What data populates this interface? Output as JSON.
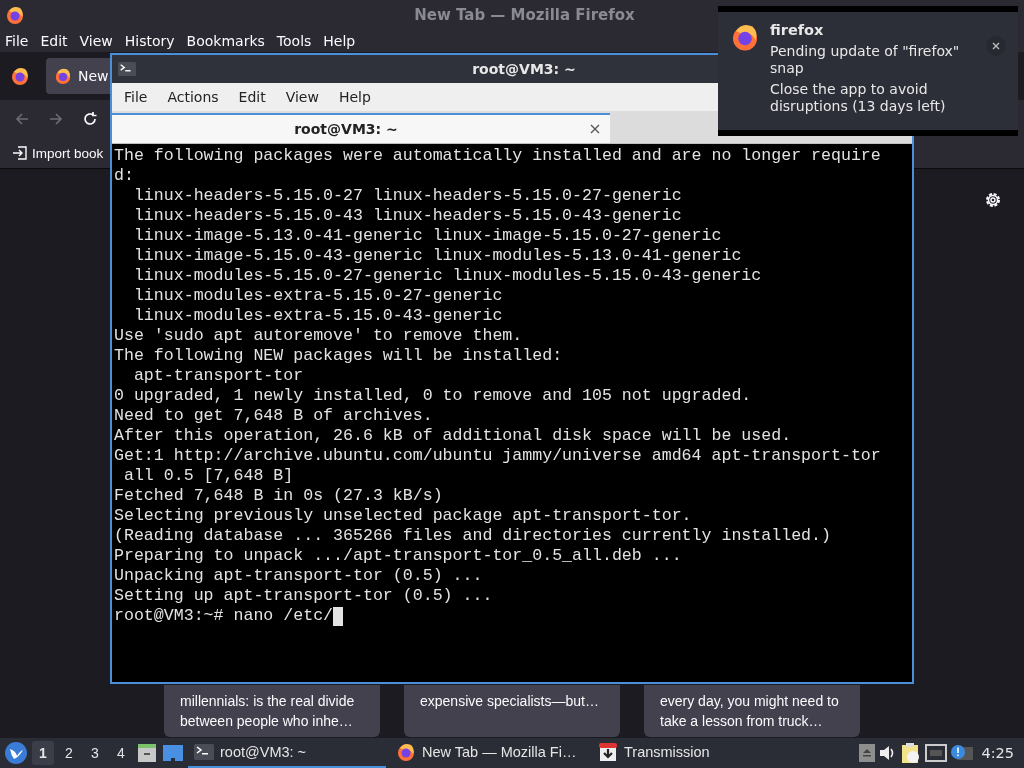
{
  "browser": {
    "title": "New Tab — Mozilla Firefox",
    "menu": [
      "File",
      "Edit",
      "View",
      "History",
      "Bookmarks",
      "Tools",
      "Help"
    ],
    "tabs": [
      {
        "label": "New",
        "selected": true
      }
    ],
    "bookmarks": [
      {
        "label": "Import book"
      }
    ],
    "cards": [
      {
        "text": "millennials: is the real divide\nbetween people who inhe…"
      },
      {
        "text": "expensive specialists—but…"
      },
      {
        "text": "every day, you might need to\ntake a lesson from truck…"
      }
    ]
  },
  "terminal": {
    "title": "root@VM3: ~",
    "menu": [
      "File",
      "Actions",
      "Edit",
      "View",
      "Help"
    ],
    "tabs": [
      {
        "label": "root@VM3: ~",
        "selected": true
      }
    ],
    "lines": [
      "The following packages were automatically installed and are no longer require",
      "d:",
      "  linux-headers-5.15.0-27 linux-headers-5.15.0-27-generic",
      "  linux-headers-5.15.0-43 linux-headers-5.15.0-43-generic",
      "  linux-image-5.13.0-41-generic linux-image-5.15.0-27-generic",
      "  linux-image-5.15.0-43-generic linux-modules-5.13.0-41-generic",
      "  linux-modules-5.15.0-27-generic linux-modules-5.15.0-43-generic",
      "  linux-modules-extra-5.15.0-27-generic",
      "  linux-modules-extra-5.15.0-43-generic",
      "Use 'sudo apt autoremove' to remove them.",
      "The following NEW packages will be installed:",
      "  apt-transport-tor",
      "0 upgraded, 1 newly installed, 0 to remove and 105 not upgraded.",
      "Need to get 7,648 B of archives.",
      "After this operation, 26.6 kB of additional disk space will be used.",
      "Get:1 http://archive.ubuntu.com/ubuntu jammy/universe amd64 apt-transport-tor",
      " all 0.5 [7,648 B]",
      "Fetched 7,648 B in 0s (27.3 kB/s)",
      "Selecting previously unselected package apt-transport-tor.",
      "(Reading database ... 365266 files and directories currently installed.)",
      "Preparing to unpack .../apt-transport-tor_0.5_all.deb ...",
      "Unpacking apt-transport-tor (0.5) ...",
      "Setting up apt-transport-tor (0.5) ...",
      "root@VM3:~# nano /etc/"
    ]
  },
  "notification": {
    "app": "firefox",
    "summary": "Pending update of \"firefox\"\nsnap",
    "body": "Close the app to avoid\ndisruptions (13 days left)"
  },
  "taskbar": {
    "workspaces": [
      {
        "label": "1",
        "selected": true
      },
      {
        "label": "2",
        "selected": false
      },
      {
        "label": "3",
        "selected": false
      },
      {
        "label": "4",
        "selected": false
      }
    ],
    "tasks": [
      {
        "label": "root@VM3: ~",
        "kind": "terminal",
        "selected": true
      },
      {
        "label": "New Tab — Mozilla Fi…",
        "kind": "browser",
        "selected": false
      },
      {
        "label": "Transmission",
        "kind": "torrent",
        "selected": false
      }
    ],
    "clock": "4:25"
  }
}
